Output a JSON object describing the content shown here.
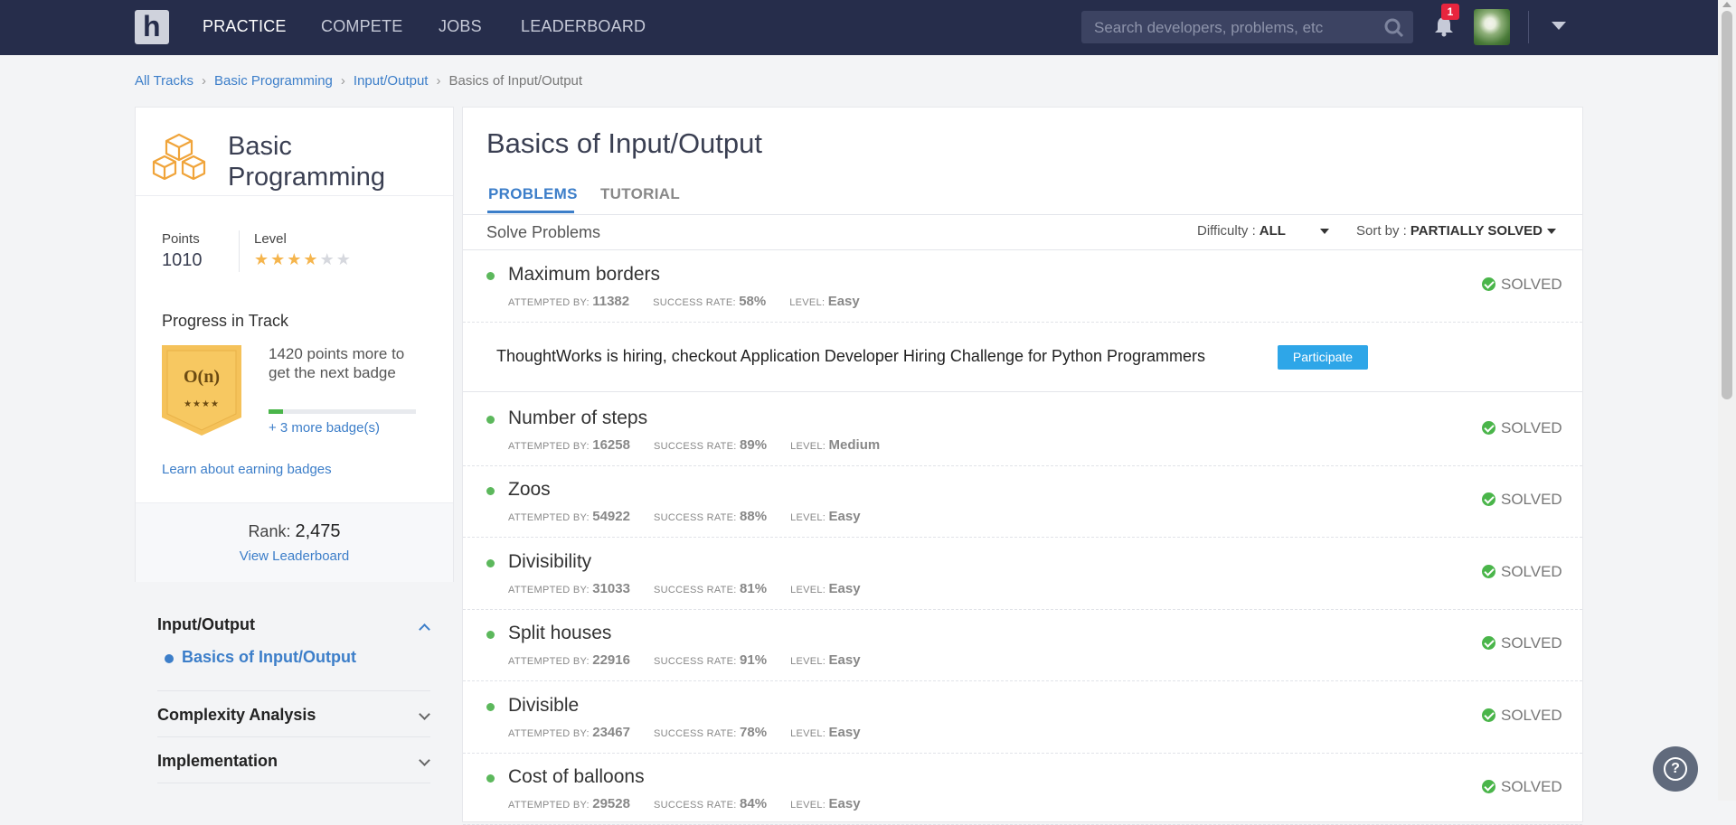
{
  "nav": {
    "logo": "h",
    "links": [
      "PRACTICE",
      "COMPETE",
      "JOBS",
      "LEADERBOARD"
    ],
    "search_placeholder": "Search developers, problems, etc",
    "notification_count": "1"
  },
  "breadcrumb": [
    "All Tracks",
    "Basic Programming",
    "Input/Output",
    "Basics of Input/Output"
  ],
  "track": {
    "title": "Basic Programming",
    "points_label": "Points",
    "points": "1010",
    "level_label": "Level",
    "level_stars": 4,
    "level_max": 6,
    "progress_title": "Progress in Track",
    "badge_text": "O(n)",
    "badge_stars": "★★★★",
    "next_badge_text": "1420 points more to get the next badge",
    "progress_fraction": 0.1,
    "more_badges": "+ 3 more badge(s)",
    "learn_link": "Learn about earning badges",
    "rank_label": "Rank:",
    "rank_value": "2,475",
    "view_leaderboard": "View Leaderboard"
  },
  "sidebar": {
    "sections": [
      "Input/Output",
      "Complexity Analysis",
      "Implementation"
    ],
    "active_item": "Basics of Input/Output"
  },
  "main": {
    "title": "Basics of Input/Output",
    "tabs": [
      "PROBLEMS",
      "TUTORIAL"
    ],
    "subheading": "Solve Problems",
    "difficulty_label": "Difficulty :",
    "difficulty_value": "ALL",
    "sort_label": "Sort by :",
    "sort_value": "PARTIALLY SOLVED",
    "meta_labels": {
      "attempted": "ATTEMPTED BY:",
      "success": "SUCCESS RATE:",
      "level": "LEVEL:"
    },
    "problems": [
      {
        "name": "Maximum borders",
        "attempted": "11382",
        "success": "58%",
        "level": "Easy",
        "status": "SOLVED"
      },
      {
        "name": "Number of steps",
        "attempted": "16258",
        "success": "89%",
        "level": "Medium",
        "status": "SOLVED"
      },
      {
        "name": "Zoos",
        "attempted": "54922",
        "success": "88%",
        "level": "Easy",
        "status": "SOLVED"
      },
      {
        "name": "Divisibility",
        "attempted": "31033",
        "success": "81%",
        "level": "Easy",
        "status": "SOLVED"
      },
      {
        "name": "Split houses",
        "attempted": "22916",
        "success": "91%",
        "level": "Easy",
        "status": "SOLVED"
      },
      {
        "name": "Divisible",
        "attempted": "23467",
        "success": "78%",
        "level": "Easy",
        "status": "SOLVED"
      },
      {
        "name": "Cost of balloons",
        "attempted": "29528",
        "success": "84%",
        "level": "Easy",
        "status": "SOLVED"
      }
    ],
    "ad": {
      "text": "ThoughtWorks is hiring, checkout Application Developer Hiring Challenge for Python Programmers",
      "button": "Participate"
    }
  },
  "help_label": "?"
}
